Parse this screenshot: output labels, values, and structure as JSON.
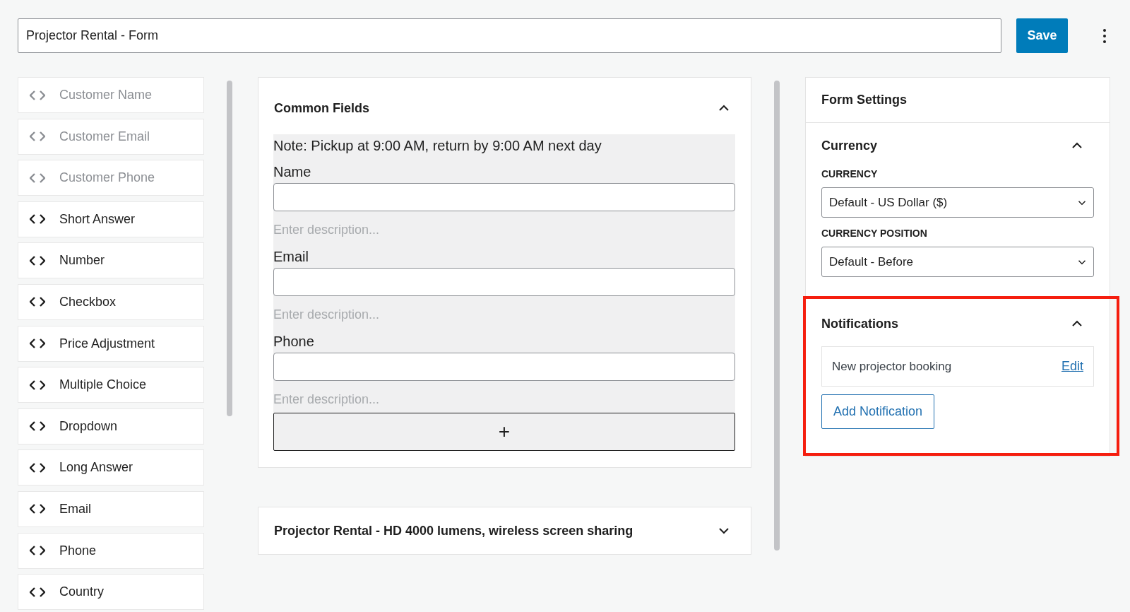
{
  "form_title": {
    "value": "Projector Rental - Form"
  },
  "save_button": "Save",
  "palette": [
    {
      "label": "Customer Name",
      "disabled": true
    },
    {
      "label": "Customer Email",
      "disabled": true
    },
    {
      "label": "Customer Phone",
      "disabled": true
    },
    {
      "label": "Short Answer",
      "disabled": false
    },
    {
      "label": "Number",
      "disabled": false
    },
    {
      "label": "Checkbox",
      "disabled": false
    },
    {
      "label": "Price Adjustment",
      "disabled": false
    },
    {
      "label": "Multiple Choice",
      "disabled": false
    },
    {
      "label": "Dropdown",
      "disabled": false
    },
    {
      "label": "Long Answer",
      "disabled": false
    },
    {
      "label": "Email",
      "disabled": false
    },
    {
      "label": "Phone",
      "disabled": false
    },
    {
      "label": "Country",
      "disabled": false
    }
  ],
  "sections": [
    {
      "title": "Common Fields",
      "expanded": true,
      "note": "Note: Pickup at 9:00 AM, return by 9:00 AM next day",
      "fields": [
        {
          "label": "Name",
          "placeholder": "Enter description..."
        },
        {
          "label": "Email",
          "placeholder": "Enter description..."
        },
        {
          "label": "Phone",
          "placeholder": "Enter description..."
        }
      ],
      "add_button": "+"
    },
    {
      "title": "Projector Rental - HD 4000 lumens, wireless screen sharing",
      "expanded": false
    }
  ],
  "settings": {
    "title": "Form Settings",
    "currency": {
      "title": "Currency",
      "expanded": true,
      "fields": [
        {
          "label": "CURRENCY",
          "value": "Default - US Dollar ($)"
        },
        {
          "label": "CURRENCY POSITION",
          "value": "Default - Before"
        }
      ]
    },
    "notifications": {
      "title": "Notifications",
      "expanded": true,
      "highlighted": true,
      "items": [
        {
          "name": "New projector booking",
          "action": "Edit"
        }
      ],
      "add_button": "Add Notification"
    }
  }
}
